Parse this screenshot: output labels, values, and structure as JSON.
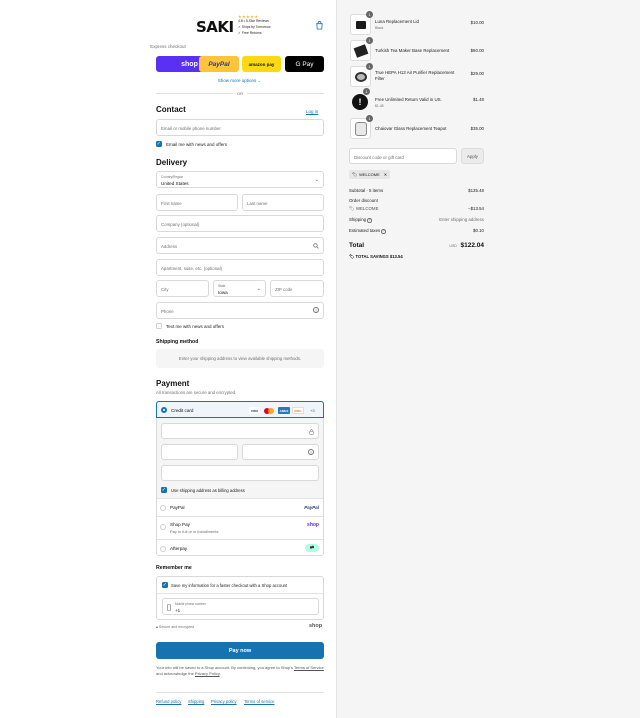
{
  "header": {
    "logo": "SAKI",
    "rating_stars": "★★★★★",
    "badges": [
      "4.8 • 5-Star Reviews",
      "Ships by Tomorrow",
      "Free Returns"
    ]
  },
  "express": {
    "label": "Express checkout",
    "buttons": [
      "shop",
      "PayPal",
      "amazon pay",
      "G Pay"
    ],
    "show_more": "Show more options ⌄",
    "or": "OR"
  },
  "contact": {
    "title": "Contact",
    "login": "Log in",
    "email_placeholder": "Email or mobile phone number",
    "news_checkbox": "Email me with news and offers"
  },
  "delivery": {
    "title": "Delivery",
    "country_label": "Country/Region",
    "country_value": "United States",
    "first_name": "First name",
    "last_name": "Last name",
    "company": "Company (optional)",
    "address": "Address",
    "apartment": "Apartment, suite, etc. (optional)",
    "city": "City",
    "state_label": "State",
    "state_value": "Iowa",
    "zip": "ZIP code",
    "phone": "Phone",
    "sms_checkbox": "Text me with news and offers"
  },
  "shipping": {
    "title": "Shipping method",
    "notice": "Enter your shipping address to view available shipping methods."
  },
  "payment": {
    "title": "Payment",
    "subtitle": "All transactions are secure and encrypted.",
    "credit_card": "Credit card",
    "card_logos": [
      "VISA",
      "MC",
      "AMEX",
      "DISC"
    ],
    "more_cards": "+3",
    "billing_checkbox": "Use shipping address as billing address",
    "paypal": "PayPal",
    "paypal_logo": "PayPal",
    "shoppay": "Shop Pay",
    "shoppay_sub": "Pay in full or in installments",
    "shoppay_logo": "shop",
    "afterpay": "Afterpay"
  },
  "remember": {
    "title": "Remember me",
    "checkbox": "Save my information for a faster checkout with a Shop account",
    "phone_label": "Mobile phone number",
    "phone_value": "+1",
    "secure": "Secure and encrypted",
    "shop_logo": "shop"
  },
  "pay_now": "Pay now",
  "legal": {
    "line1": "Your info will be saved to a Shop account. By continuing, you agree to Shop's",
    "terms": "Terms of Service",
    "mid": " and acknowledge the ",
    "privacy": "Privacy Policy",
    "end": "."
  },
  "footer_links": [
    "Refund policy",
    "Shipping",
    "Privacy policy",
    "Terms of service"
  ],
  "order": {
    "items": [
      {
        "qty": "1",
        "name": "Luna Replacement Lid",
        "variant": "Black",
        "price": "$10.00"
      },
      {
        "qty": "1",
        "name": "Turkish Tea Maker Base Replacement",
        "variant": "",
        "price": "$60.00"
      },
      {
        "qty": "1",
        "name": "True HEPA H13 Air Purifier Replacement Filter",
        "variant": "",
        "price": "$29.00"
      },
      {
        "qty": "1",
        "name": "Free Unlimited Return Valid in US.",
        "variant": "$1.48",
        "price": "$1.48"
      },
      {
        "qty": "1",
        "name": "Chaiovar Glass Replacement Teapot",
        "variant": "",
        "price": "$35.00"
      }
    ],
    "discount_placeholder": "Discount code or gift card",
    "apply": "Apply",
    "discount_tag": "WELCOME",
    "subtotal_label": "Subtotal · 5 items",
    "subtotal": "$135.48",
    "order_discount_label": "Order discount",
    "discount_code": "WELCOME",
    "discount_amount": "−$13.54",
    "shipping_label": "Shipping",
    "shipping_value": "Enter shipping address",
    "taxes_label": "Estimated taxes",
    "taxes_value": "$0.10",
    "total_label": "Total",
    "currency": "USD",
    "total": "$122.04",
    "savings_label": "TOTAL SAVINGS",
    "savings": "$13.54"
  }
}
